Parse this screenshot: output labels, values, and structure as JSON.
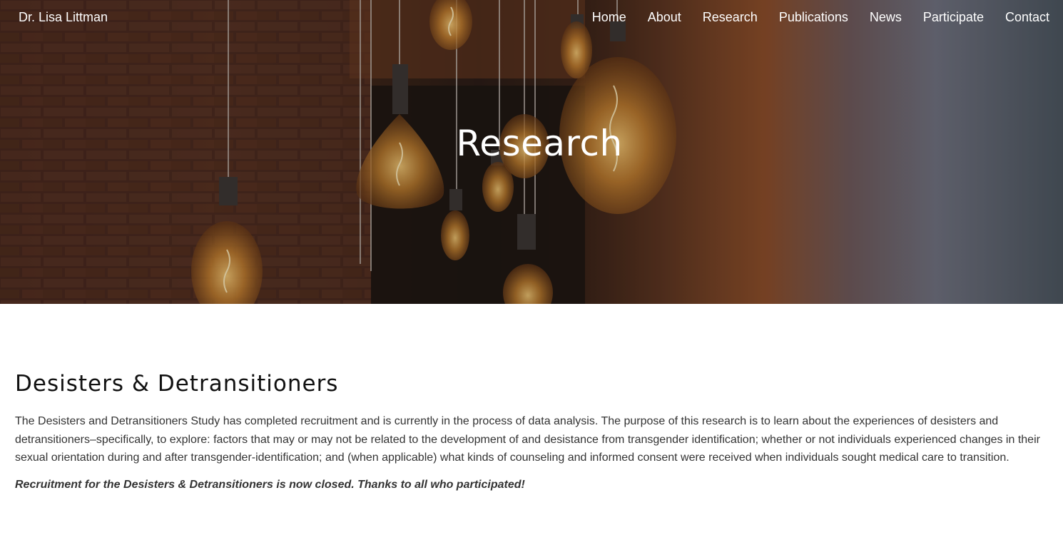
{
  "header": {
    "site_title": "Dr. Lisa Littman",
    "nav": [
      {
        "label": "Home"
      },
      {
        "label": "About"
      },
      {
        "label": "Research"
      },
      {
        "label": "Publications"
      },
      {
        "label": "News"
      },
      {
        "label": "Participate"
      },
      {
        "label": "Contact"
      }
    ]
  },
  "hero": {
    "title": "Research",
    "image": "hanging-edison-bulbs"
  },
  "section": {
    "heading": "Desisters & Detransitioners",
    "body": "The Desisters and Detransitioners Study has completed recruitment and is currently in the process of data analysis. The purpose of this research is to learn about the experiences of desisters and detransitioners–specifically, to explore: factors that may or may not be related to the development of and desistance from transgender identification; whether or not individuals experienced changes in their sexual orientation during and after transgender-identification; and (when applicable) what kinds of counseling and informed consent were received when individuals sought medical care to transition.",
    "notice": "Recruitment for the Desisters & Detransitioners is now closed. Thanks to all who participated!"
  },
  "colors": {
    "bulb_glow": "#e0a24a",
    "brick": "#5a3426",
    "text": "#333333",
    "heading": "#111111"
  }
}
